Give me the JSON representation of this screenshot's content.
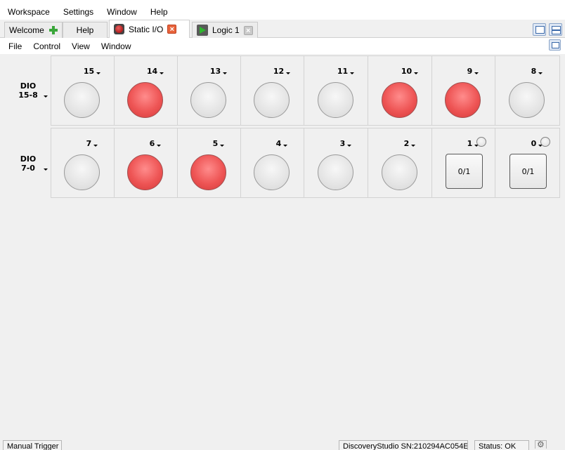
{
  "menubar": {
    "items": [
      "Workspace",
      "Settings",
      "Window",
      "Help"
    ]
  },
  "tabs": [
    {
      "label": "Welcome",
      "icon": "plus-icon"
    },
    {
      "label": "Help",
      "icon": ""
    },
    {
      "label": "Static I/O",
      "icon": "record-icon",
      "closable": true,
      "active": true
    },
    {
      "label": "Logic 1",
      "icon": "play-icon",
      "closable": true
    }
  ],
  "innermenu": {
    "items": [
      "File",
      "Control",
      "View",
      "Window"
    ]
  },
  "rows": [
    {
      "label_line1": "DIO",
      "label_line2": "15-8",
      "pins": [
        {
          "pin": "15",
          "type": "led",
          "state": "off"
        },
        {
          "pin": "14",
          "type": "led",
          "state": "on"
        },
        {
          "pin": "13",
          "type": "led",
          "state": "off"
        },
        {
          "pin": "12",
          "type": "led",
          "state": "off"
        },
        {
          "pin": "11",
          "type": "led",
          "state": "off"
        },
        {
          "pin": "10",
          "type": "led",
          "state": "on"
        },
        {
          "pin": "9",
          "type": "led",
          "state": "on"
        },
        {
          "pin": "8",
          "type": "led",
          "state": "off"
        }
      ]
    },
    {
      "label_line1": "DIO",
      "label_line2": "7-0",
      "pins": [
        {
          "pin": "7",
          "type": "led",
          "state": "off"
        },
        {
          "pin": "6",
          "type": "led",
          "state": "on"
        },
        {
          "pin": "5",
          "type": "led",
          "state": "on"
        },
        {
          "pin": "4",
          "type": "led",
          "state": "off"
        },
        {
          "pin": "3",
          "type": "led",
          "state": "off"
        },
        {
          "pin": "2",
          "type": "led",
          "state": "off"
        },
        {
          "pin": "1",
          "type": "button",
          "button_label": "0/1"
        },
        {
          "pin": "0",
          "type": "button",
          "button_label": "0/1"
        }
      ]
    }
  ],
  "statusbar": {
    "manual_trigger": "Manual Trigger",
    "device": "DiscoveryStudio SN:210294AC054E",
    "status": "Status: OK"
  },
  "colors": {
    "led_on": "#ee5555",
    "led_off": "#e4e4e4",
    "close_active": "#e8643c"
  }
}
